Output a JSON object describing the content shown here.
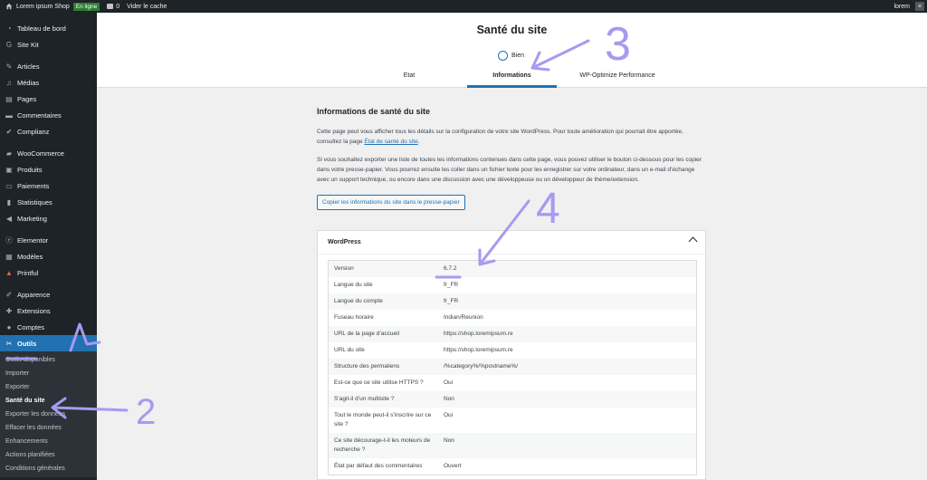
{
  "adminbar": {
    "site_name": "Lorem ipsum Shop",
    "status_badge": "En ligne",
    "comments_count": "0",
    "clear_cache": "Vider le cache",
    "user": "lorem"
  },
  "sidebar": {
    "items": [
      {
        "label": "Tableau de bord",
        "icon": "dashboard-icon"
      },
      {
        "label": "Site Kit",
        "icon": "sitekit-icon"
      },
      {
        "label": "Articles",
        "icon": "pin-icon"
      },
      {
        "label": "Médias",
        "icon": "media-icon"
      },
      {
        "label": "Pages",
        "icon": "page-icon"
      },
      {
        "label": "Commentaires",
        "icon": "comment-icon"
      },
      {
        "label": "Complianz",
        "icon": "check-icon"
      },
      {
        "label": "WooCommerce",
        "icon": "woo-icon"
      },
      {
        "label": "Produits",
        "icon": "product-icon"
      },
      {
        "label": "Paiements",
        "icon": "payment-icon"
      },
      {
        "label": "Statistiques",
        "icon": "stats-icon"
      },
      {
        "label": "Marketing",
        "icon": "megaphone-icon"
      },
      {
        "label": "Elementor",
        "icon": "elementor-icon"
      },
      {
        "label": "Modèles",
        "icon": "templates-icon"
      },
      {
        "label": "Printful",
        "icon": "printful-icon"
      },
      {
        "label": "Apparence",
        "icon": "brush-icon"
      },
      {
        "label": "Extensions",
        "icon": "plugin-icon"
      },
      {
        "label": "Comptes",
        "icon": "user-icon"
      },
      {
        "label": "Outils",
        "icon": "wrench-icon"
      }
    ],
    "submenu": [
      "Outils disponibles",
      "Importer",
      "Exporter",
      "Santé du site",
      "Exporter les données",
      "Effacer les données",
      "Enhancements",
      "Actions planifiées",
      "Conditions générales"
    ]
  },
  "header": {
    "title": "Santé du site",
    "status": "Bien",
    "tabs": [
      "Etat",
      "Informations",
      "WP-Optimize Performance"
    ]
  },
  "content": {
    "heading": "Informations de santé du site",
    "para1_before": "Cette page peut vous afficher tous les détails sur la configuration de votre site WordPress. Pour toute amélioration qui pourrait être apportée, consultez la page ",
    "para1_link": "État de santé du site",
    "para1_after": ".",
    "para2": "Si vous souhaitez exporter une liste de toutes les informations contenues dans cette page, vous pouvez utiliser le bouton ci-dessous pour les copier dans votre presse-papier. Vous pourrez ensuite les coller dans un fichier texte pour les enregistrer sur votre ordinateur, dans un e-mail d’échange avec un support technique, ou encore dans une discussion avec une développeuse ou un développeur de thème/extension.",
    "copy_button": "Copier les informations du site dans le presse-papier"
  },
  "wordpress_panel": {
    "title": "WordPress",
    "rows": [
      {
        "k": "Version",
        "v": "6.7.2"
      },
      {
        "k": "Langue du site",
        "v": "fr_FR"
      },
      {
        "k": "Langue du compte",
        "v": "fr_FR"
      },
      {
        "k": "Fuseau horaire",
        "v": "Indian/Reunion"
      },
      {
        "k": "URL de la page d’accueil",
        "v": "https://shop.loremipsum.re"
      },
      {
        "k": "URL du site",
        "v": "https://shop.loremipsum.re"
      },
      {
        "k": "Structure des permaliens",
        "v": "/%category%/%postname%/"
      },
      {
        "k": "Est-ce que ce site utilise HTTPS ?",
        "v": "Oui"
      },
      {
        "k": "S’agit-il d’un multisite ?",
        "v": "Non"
      },
      {
        "k": "Tout le monde peut-il s’inscrire sur ce site ?",
        "v": "Oui"
      },
      {
        "k": "Ce site décourage-t-il les moteurs de recherche ?",
        "v": "Non"
      },
      {
        "k": "État par défaut des commentaires",
        "v": "Ouvert"
      }
    ]
  },
  "annotations": {
    "numbers": [
      "2",
      "3",
      "4"
    ],
    "color": "#a79af0"
  }
}
